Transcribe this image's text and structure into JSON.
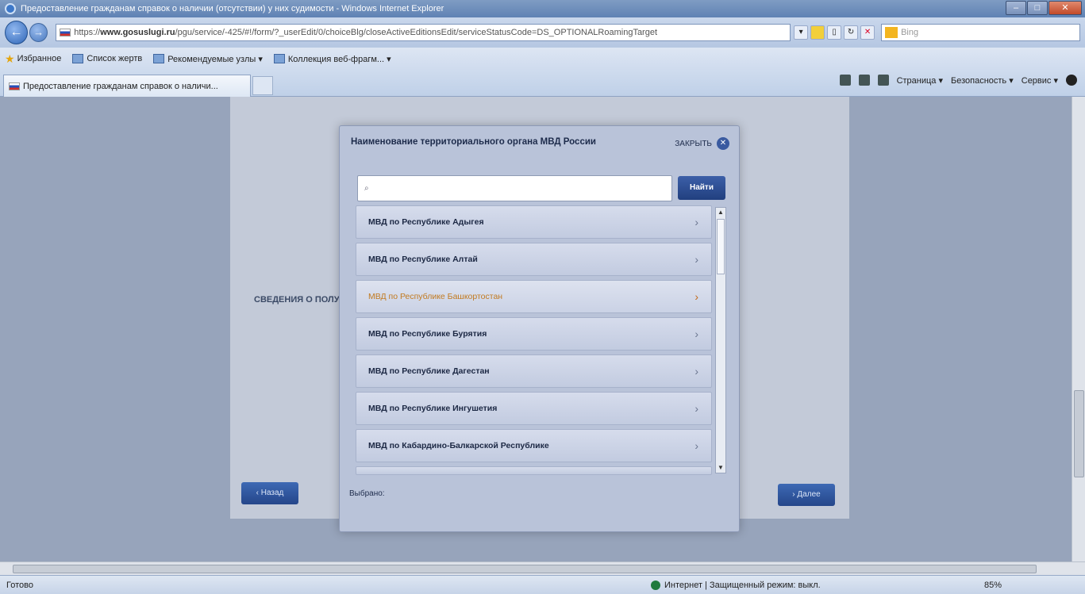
{
  "window": {
    "title": "Предоставление гражданам справок о наличии (отсутствии) у них судимости - Windows Internet Explorer"
  },
  "nav": {
    "url_prefix": "https://",
    "url_domain": "www.gosuslugi.ru",
    "url_rest": "/pgu/service/-425/#!/form/?_userEdit/0/choiceBlg/closeActiveEditionsEdit/serviceStatusCode=DS_OPTIONALRoamingTarget",
    "bing_placeholder": "Bing"
  },
  "favorites": {
    "label": "Избранное",
    "items": [
      "Список жертв",
      "Рекомендуемые узлы ▾",
      "Коллекция веб-фрагм... ▾"
    ]
  },
  "tab": {
    "label": "Предоставление гражданам справок о наличи..."
  },
  "command_bar": {
    "page": "Страница ▾",
    "safety": "Безопасность ▾",
    "tools": "Сервис ▾"
  },
  "background": {
    "heading": "СВЕДЕНИЯ О ПОЛУЧ",
    "back_button": "‹ Назад",
    "next_button": "› Далее"
  },
  "modal": {
    "title": "Наименование территориального органа МВД России",
    "close_label": "ЗАКРЫТЬ",
    "search_placeholder": "",
    "find_button": "Найти",
    "items": [
      {
        "label": "МВД по Республике Адыгея",
        "selected": false
      },
      {
        "label": "МВД по Республике Алтай",
        "selected": false
      },
      {
        "label": "МВД по Республике Башкортостан",
        "selected": true
      },
      {
        "label": "МВД по Республике Бурятия",
        "selected": false
      },
      {
        "label": "МВД по Республике Дагестан",
        "selected": false
      },
      {
        "label": "МВД по Республике Ингушетия",
        "selected": false
      },
      {
        "label": "МВД по Кабардино-Балкарской Республике",
        "selected": false
      }
    ],
    "selected_label": "Выбрано:"
  },
  "status": {
    "left": "Готово",
    "zone": "Интернет | Защищенный режим: выкл.",
    "zoom": "85%"
  }
}
